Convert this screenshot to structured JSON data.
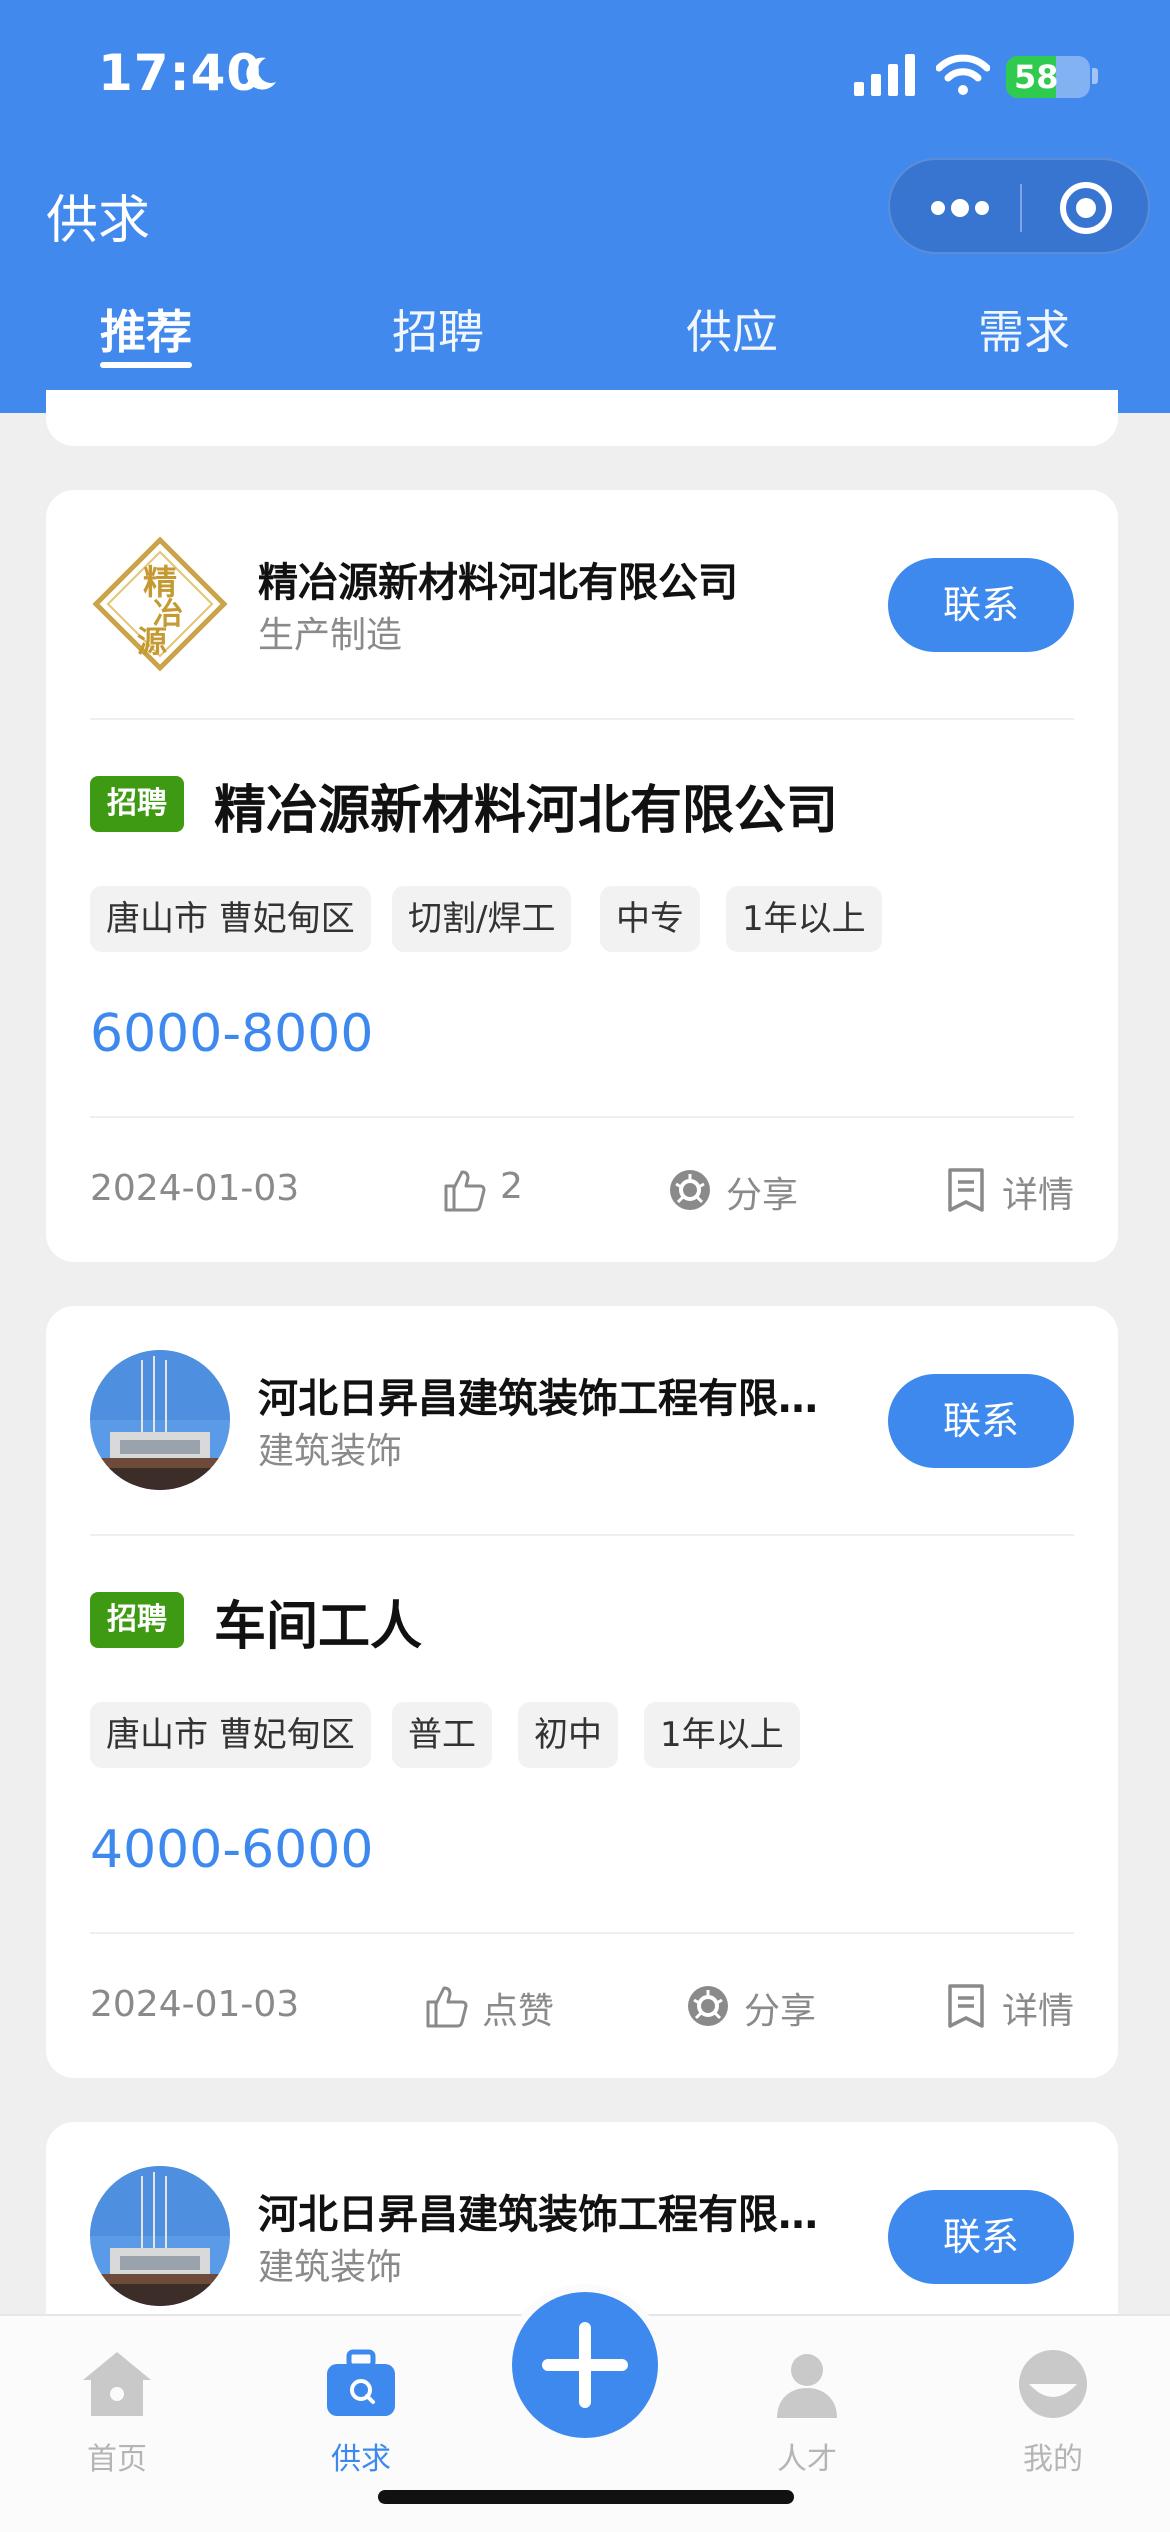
{
  "status_bar": {
    "time": "17:40",
    "battery": "58"
  },
  "header": {
    "title": "供求"
  },
  "tabs": [
    {
      "label": "推荐",
      "active": true
    },
    {
      "label": "招聘"
    },
    {
      "label": "供应"
    },
    {
      "label": "需求"
    }
  ],
  "cards": [
    {
      "company": "精冶源新材料河北有限公司",
      "industry": "生产制造",
      "logo_icon": "jingyeyuan-logo",
      "contact_label": "联系",
      "badge": "招聘",
      "job_title": "精冶源新材料河北有限公司",
      "tags": [
        "唐山市 曹妃甸区",
        "切割/焊工",
        "中专",
        "1年以上"
      ],
      "salary": "6000-8000",
      "date": "2024-01-03",
      "like_label": "2",
      "share_label": "分享",
      "detail_label": "详情"
    },
    {
      "company": "河北日昇昌建筑装饰工程有限公司",
      "industry": "建筑装饰",
      "logo_icon": "building-photo",
      "contact_label": "联系",
      "badge": "招聘",
      "job_title": "车间工人",
      "tags": [
        "唐山市 曹妃甸区",
        "普工",
        "初中",
        "1年以上"
      ],
      "salary": "4000-6000",
      "date": "2024-01-03",
      "like_label": "点赞",
      "share_label": "分享",
      "detail_label": "详情"
    },
    {
      "company": "河北日昇昌建筑装饰工程有限公司",
      "industry": "建筑装饰",
      "logo_icon": "building-photo",
      "contact_label": "联系"
    }
  ],
  "bottom_nav": [
    {
      "label": "首页",
      "icon": "home-icon"
    },
    {
      "label": "供求",
      "icon": "briefcase-icon",
      "active": true
    },
    {
      "label": "",
      "icon": "plus-icon"
    },
    {
      "label": "人才",
      "icon": "person-icon"
    },
    {
      "label": "我的",
      "icon": "profile-icon"
    }
  ],
  "colors": {
    "primary": "#3e89ee",
    "header": "#4189ec",
    "badge": "#3d9a12"
  }
}
